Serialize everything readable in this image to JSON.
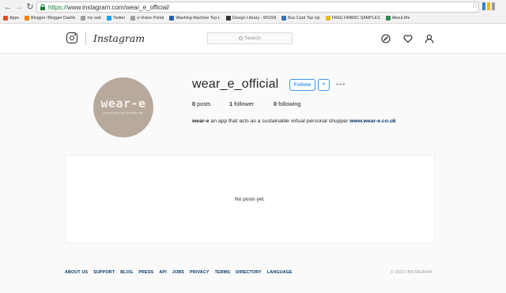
{
  "browser": {
    "url_secure": "https://",
    "url_rest": "www.instagram.com/wear_e_official/",
    "bookmarks": [
      {
        "label": "Apps",
        "color": "#e44d26"
      },
      {
        "label": "Blogger: Blogger Dashb",
        "color": "#f57d00"
      },
      {
        "label": "my aub",
        "color": "#9e9e9e"
      },
      {
        "label": "Twitter",
        "color": "#1da1f2"
      },
      {
        "label": "e:Vision Portal",
        "color": "#9e9e9e"
      },
      {
        "label": "Washing Machine Top-L",
        "color": "#2a5db0"
      },
      {
        "label": "Design Library - WGSN",
        "color": "#333333"
      },
      {
        "label": "Bus Card Top Up",
        "color": "#3b6fb6"
      },
      {
        "label": "FREE FABRIC SAMPLES",
        "color": "#e6b800"
      },
      {
        "label": "About.Me",
        "color": "#2e8b57"
      }
    ]
  },
  "header": {
    "wordmark": "Instagram",
    "search_placeholder": "Search"
  },
  "profile": {
    "avatar_text": "wear-e",
    "avatar_subtext": "virtual personal shopper app",
    "username": "wear_e_official",
    "follow_label": "Follow",
    "dropdown_glyph": "▾",
    "more_glyph": "•••",
    "posts_count": "0",
    "posts_label": "posts",
    "followers_count": "1",
    "followers_label": "follower",
    "following_count": "0",
    "following_label": "following",
    "bio_name": "wear-e",
    "bio_text": " an app that acts as a sustainable virtual personal shopper ",
    "bio_link": "www.wear-e.co.uk"
  },
  "posts": {
    "empty_text": "No posts yet."
  },
  "footer": {
    "links": [
      "ABOUT US",
      "SUPPORT",
      "BLOG",
      "PRESS",
      "API",
      "JOBS",
      "PRIVACY",
      "TERMS",
      "DIRECTORY",
      "LANGUAGE"
    ],
    "copyright": "© 2016 INSTAGRAM"
  }
}
